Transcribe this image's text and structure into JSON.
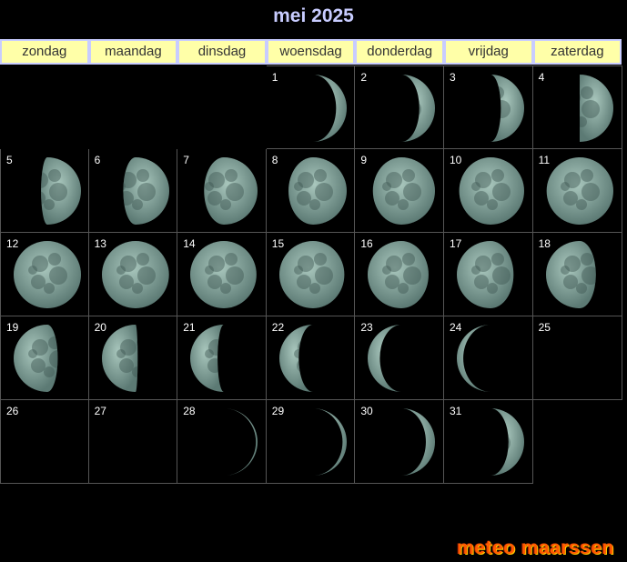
{
  "calendar": {
    "title": "mei 2025",
    "weekdays": [
      "zondag",
      "maandag",
      "dinsdag",
      "woensdag",
      "donderdag",
      "vrijdag",
      "zaterdag"
    ],
    "first_weekday_index": 3,
    "days": [
      {
        "day": "1",
        "phase": 0.13
      },
      {
        "day": "2",
        "phase": 0.16
      },
      {
        "day": "3",
        "phase": 0.2
      },
      {
        "day": "4",
        "phase": 0.25
      },
      {
        "day": "5",
        "phase": 0.28
      },
      {
        "day": "6",
        "phase": 0.31
      },
      {
        "day": "7",
        "phase": 0.35
      },
      {
        "day": "8",
        "phase": 0.38
      },
      {
        "day": "9",
        "phase": 0.41
      },
      {
        "day": "10",
        "phase": 0.44
      },
      {
        "day": "11",
        "phase": 0.47
      },
      {
        "day": "12",
        "phase": 0.5
      },
      {
        "day": "13",
        "phase": 0.52
      },
      {
        "day": "14",
        "phase": 0.54
      },
      {
        "day": "15",
        "phase": 0.56
      },
      {
        "day": "16",
        "phase": 0.6
      },
      {
        "day": "17",
        "phase": 0.63
      },
      {
        "day": "18",
        "phase": 0.67
      },
      {
        "day": "19",
        "phase": 0.7
      },
      {
        "day": "20",
        "phase": 0.74
      },
      {
        "day": "21",
        "phase": 0.78
      },
      {
        "day": "22",
        "phase": 0.82
      },
      {
        "day": "23",
        "phase": 0.86
      },
      {
        "day": "24",
        "phase": 0.9
      },
      {
        "day": "25",
        "phase": 0.97
      },
      {
        "day": "26",
        "phase": 0.0
      },
      {
        "day": "27",
        "phase": 0.01
      },
      {
        "day": "28",
        "phase": 0.05
      },
      {
        "day": "29",
        "phase": 0.08
      },
      {
        "day": "30",
        "phase": 0.12
      },
      {
        "day": "31",
        "phase": 0.16
      }
    ]
  },
  "colors": {
    "moon_lit": "#8fb3a9",
    "moon_dark_tint": "#5c7a74",
    "title": "#c8ccff",
    "header_bg": "#ffffa8"
  },
  "footer": {
    "logo_text": "meteo maarssen"
  }
}
